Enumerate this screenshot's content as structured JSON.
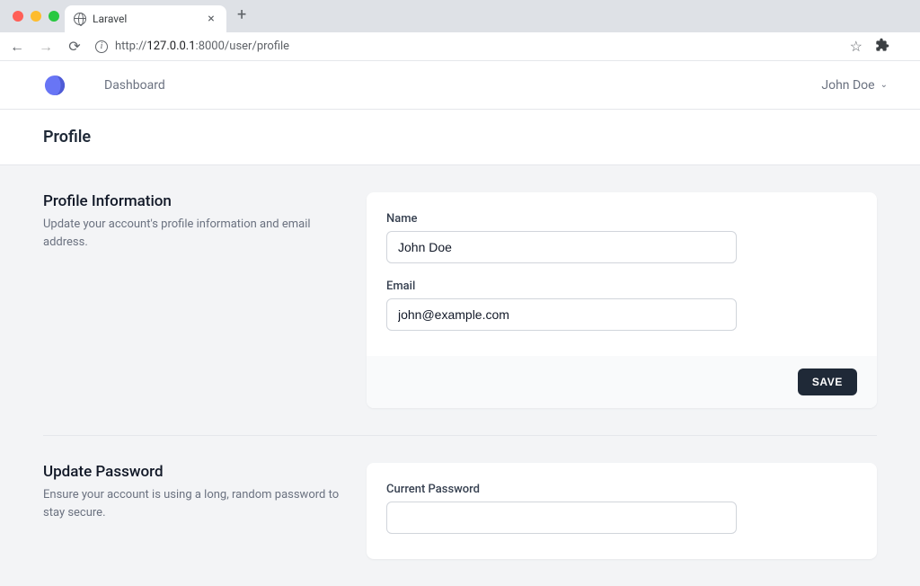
{
  "browser": {
    "tab_title": "Laravel",
    "url_prefix": "http://",
    "url_host": "127.0.0.1",
    "url_path": ":8000/user/profile"
  },
  "nav": {
    "dashboard_label": "Dashboard",
    "user_name": "John Doe"
  },
  "page": {
    "title": "Profile"
  },
  "sections": {
    "profile_info": {
      "title": "Profile Information",
      "desc": "Update your account's profile information and email address.",
      "name_label": "Name",
      "name_value": "John Doe",
      "email_label": "Email",
      "email_value": "john@example.com",
      "save_label": "SAVE"
    },
    "update_password": {
      "title": "Update Password",
      "desc": "Ensure your account is using a long, random password to stay secure.",
      "current_password_label": "Current Password"
    }
  }
}
